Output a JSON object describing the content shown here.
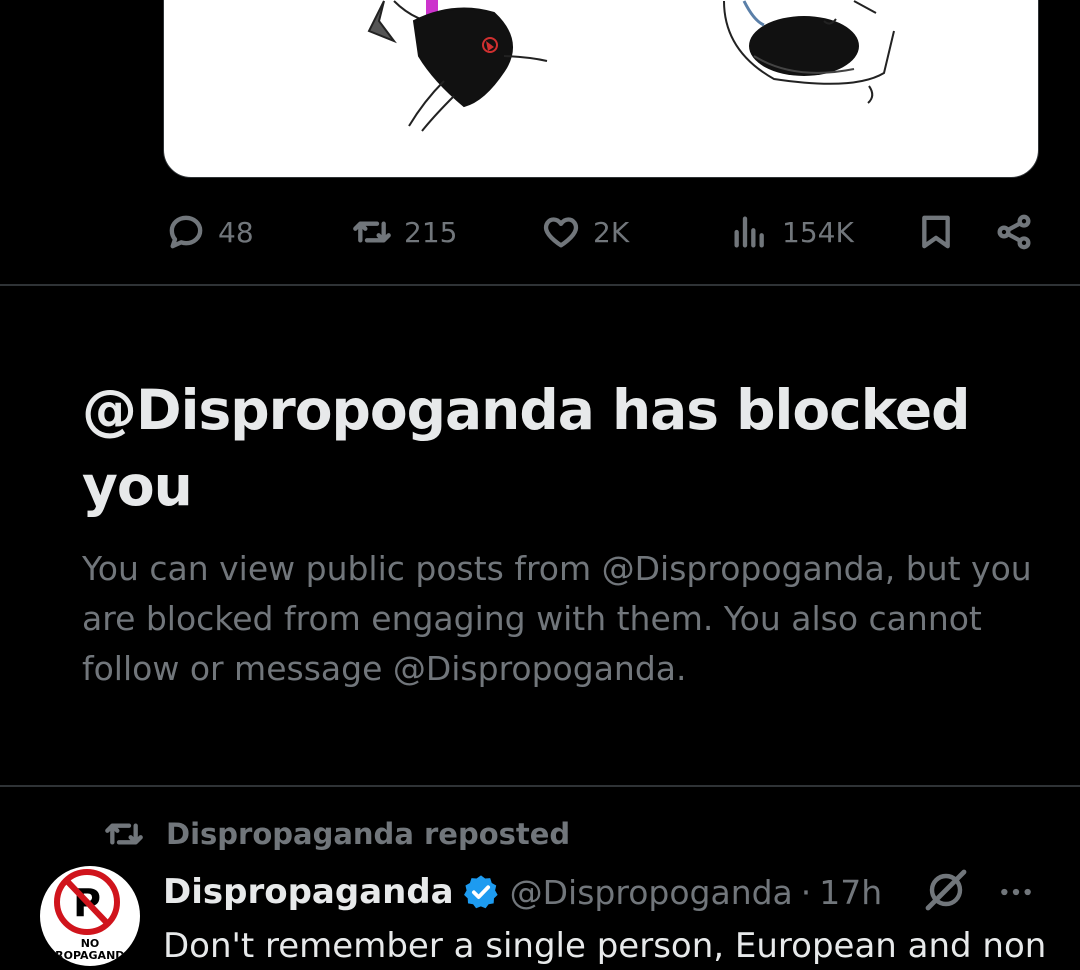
{
  "post_actions": {
    "replies": "48",
    "reposts": "215",
    "likes": "2K",
    "views": "154K"
  },
  "blocked_notice": {
    "title": "@Dispropoganda has blocked you",
    "body": "You can view public posts from @Dispropoganda, but you are blocked from engaging with them. You also cannot follow or message @Dispropoganda."
  },
  "repost": {
    "label": "Dispropaganda reposted",
    "author_name": "Dispropaganda",
    "author_handle": "@Dispropoganda",
    "separator": "·",
    "time": "17h",
    "text": "Don't remember a single person, European and non",
    "avatar_caption_1": "NO",
    "avatar_caption_2": "PROPAGANDA",
    "avatar_letter": "P"
  },
  "colors": {
    "background": "#000000",
    "text_primary": "#e7e9ea",
    "text_secondary": "#71767b",
    "divider": "#2f3336",
    "verified": "#1d9bf0"
  },
  "icons": [
    "reply-icon",
    "repost-icon",
    "like-icon",
    "views-icon",
    "bookmark-icon",
    "share-icon",
    "verified-icon",
    "grok-icon",
    "more-icon"
  ]
}
